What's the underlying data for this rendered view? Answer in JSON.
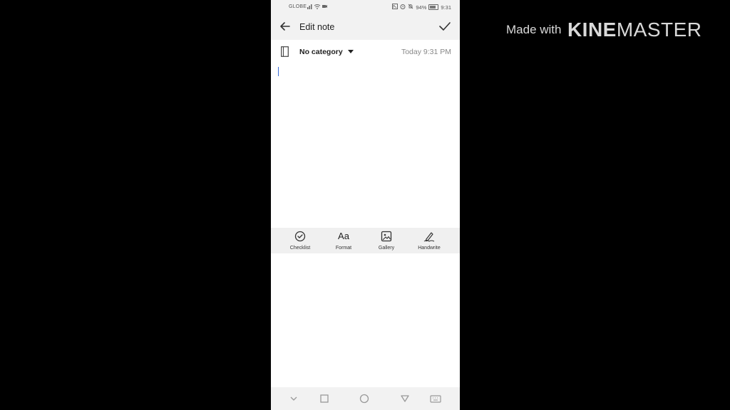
{
  "status_bar": {
    "carrier": "GLOBE",
    "battery": "94%",
    "time": "9:31"
  },
  "app_bar": {
    "title": "Edit note"
  },
  "note": {
    "category": "No category",
    "date": "Today 9:31 PM",
    "body": ""
  },
  "toolbar": {
    "items": [
      {
        "label": "Checklist",
        "icon": "checklist-icon"
      },
      {
        "label": "Format",
        "icon": "format-icon",
        "glyph": "Aa"
      },
      {
        "label": "Gallery",
        "icon": "gallery-icon"
      },
      {
        "label": "Handwrite",
        "icon": "handwrite-icon"
      }
    ]
  },
  "nav_bar": {
    "items": [
      "chevron-down-icon",
      "recents-icon",
      "home-icon",
      "back-triangle-icon",
      "keyboard-icon"
    ]
  },
  "watermark": {
    "prefix": "Made with",
    "brand_bold": "KINE",
    "brand_regular": "MASTER"
  },
  "colors": {
    "background": "#000000",
    "screen": "#ffffff",
    "bars": "#f2f2f2",
    "cursor": "#3b6ed8"
  }
}
